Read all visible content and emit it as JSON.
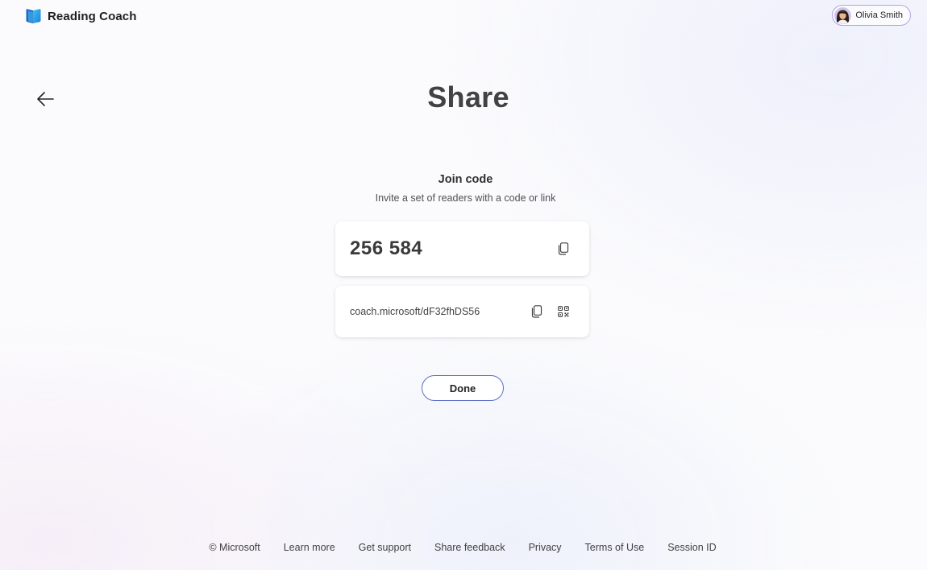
{
  "header": {
    "app_name": "Reading Coach",
    "logo_icon": "book-logo-icon",
    "user": {
      "name": "Olivia Smith",
      "avatar_icon": "user-avatar"
    }
  },
  "nav": {
    "back_icon": "arrow-left-icon"
  },
  "page": {
    "title": "Share"
  },
  "join": {
    "title": "Join code",
    "subtitle": "Invite a set of readers with a code or link",
    "code": "256 584",
    "link": "coach.microsoft/dF32fhDS56",
    "copy_icon": "copy-icon",
    "qr_icon": "qr-code-icon"
  },
  "actions": {
    "done_label": "Done"
  },
  "footer": {
    "copyright": "© Microsoft",
    "links": [
      "Learn more",
      "Get support",
      "Share feedback",
      "Privacy",
      "Terms of Use",
      "Session ID"
    ]
  },
  "colors": {
    "accent": "#5b6fc4",
    "chip_border": "#b7a2e4",
    "logo_blue": "#2aa0e6"
  }
}
